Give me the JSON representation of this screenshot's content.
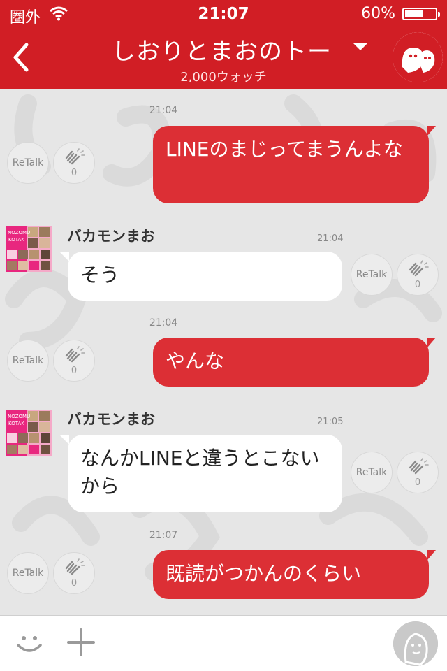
{
  "status_bar": {
    "carrier": "圏外",
    "time": "21:07",
    "battery_text": "60%",
    "battery_level": 0.6
  },
  "header": {
    "title": "しおりとまおのトー",
    "subtitle": "2,000ウォッチ"
  },
  "colors": {
    "accent": "#d11e25",
    "bubble_out": "#dc2f35",
    "chat_bg": "#e6e6e6"
  },
  "actions": {
    "retalk_label": "ReTalk"
  },
  "messages": [
    {
      "direction": "out",
      "time": "21:04",
      "text": "LINEのまじってまうんよな",
      "claps": "0"
    },
    {
      "direction": "in",
      "sender": "バカモンまお",
      "time": "21:04",
      "text": "そう",
      "claps": "0"
    },
    {
      "direction": "out",
      "time": "21:04",
      "text": "やんな",
      "claps": "0"
    },
    {
      "direction": "in",
      "sender": "バカモンまお",
      "time": "21:05",
      "text": "なんかLINEと違うとこないから",
      "claps": "0"
    },
    {
      "direction": "out",
      "time": "21:07",
      "text": "既読がつかんのくらい",
      "claps": "0"
    }
  ],
  "icons": {
    "back": "chevron-left-icon",
    "menu": "caret-down-icon",
    "clap": "clap-icon",
    "emoji": "smile-icon",
    "add": "plus-icon",
    "profile": "profile-icon"
  }
}
